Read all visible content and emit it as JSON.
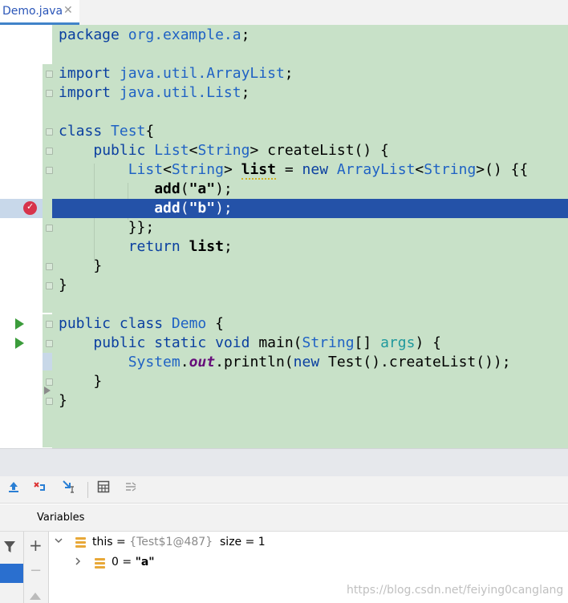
{
  "tab": {
    "title": "Demo.java",
    "close": "✕"
  },
  "code": {
    "l1": {
      "kw": "package",
      "pkg": "org.example.a",
      "end": ";"
    },
    "l3": {
      "kw": "import",
      "pkg": "java.util.ArrayList",
      "end": ";"
    },
    "l4": {
      "kw": "import",
      "pkg": "java.util.List",
      "end": ";"
    },
    "l6": {
      "kw": "class",
      "name": "Test",
      "end": "{"
    },
    "l7": {
      "kw": "public",
      "type": "List",
      "lt": "<",
      "targ": "String",
      "gt": ">",
      "method": "createList",
      "end": "() {"
    },
    "l8": {
      "type": "List",
      "lt": "<",
      "targ": "String",
      "gt": ">",
      "var": "list",
      "eq": "=",
      "kw": "new",
      "impl": "ArrayList",
      "lt2": "<",
      "targ2": "String",
      "gt2": ">",
      "end": "() {{"
    },
    "l9": {
      "call": "add",
      "open": "(",
      "arg": "\"a\"",
      "close": ");"
    },
    "l10": {
      "call": "add",
      "open": "(",
      "arg": "\"b\"",
      "close": ");"
    },
    "l11": {
      "text": "}};"
    },
    "l12": {
      "kw": "return",
      "var": "list",
      "end": ";"
    },
    "l13": {
      "text": "}"
    },
    "l14": {
      "text": "}"
    },
    "l16": {
      "kw1": "public",
      "kw2": "class",
      "name": "Demo",
      "end": "{"
    },
    "l17": {
      "kw1": "public",
      "kw2": "static",
      "kw3": "void",
      "method": "main",
      "open": "(",
      "type": "String",
      "arr": "[]",
      "param": "args",
      "end": ") {"
    },
    "l18": {
      "cls": "System",
      "dot1": ".",
      "field": "out",
      "dot2": ".",
      "method": "println",
      "open": "(",
      "kw": "new",
      "ctor": "Test",
      "mid": "().",
      "call": "createList",
      "end": "());"
    },
    "l19": {
      "text": "}"
    },
    "l20": {
      "text": "}"
    }
  },
  "debugger": {
    "toolbar": [
      "show-execution-point-icon",
      "drop-frame-icon",
      "run-to-cursor-icon",
      "evaluate-expression-icon",
      "trace-icon"
    ],
    "variables_title": "Variables",
    "add_button": "+",
    "remove_button": "−",
    "variables": [
      {
        "name": "this",
        "eq": " = ",
        "meta": "{Test$1@487}",
        "extra": "  size = 1",
        "expanded": true
      },
      {
        "name": "0",
        "eq": " = ",
        "value": "\"a\"",
        "expanded": false
      }
    ]
  },
  "watermark": "https://blog.csdn.net/feiying0canglang",
  "colors": {
    "editor_bg": "#c8e1c8",
    "current_line": "#2452a8",
    "keyword": "#0a3fa0",
    "type": "#1f62c4",
    "breakpoint": "#d7344c"
  }
}
